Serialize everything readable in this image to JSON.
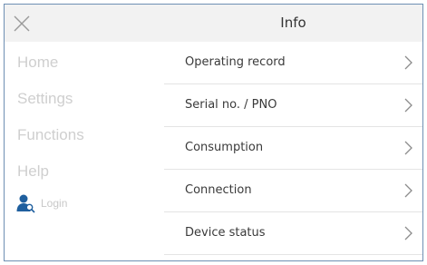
{
  "header": {
    "title": "Info",
    "close_icon": "close-icon"
  },
  "sidebar": {
    "items": [
      {
        "label": "Home"
      },
      {
        "label": "Settings"
      },
      {
        "label": "Functions"
      },
      {
        "label": "Help"
      }
    ],
    "login": {
      "label": "Login",
      "icon": "user-key-icon"
    }
  },
  "list": {
    "rows": [
      {
        "label": "Operating record"
      },
      {
        "label": "Serial no. / PNO"
      },
      {
        "label": "Consumption"
      },
      {
        "label": "Connection"
      },
      {
        "label": "Device status"
      }
    ],
    "chevron_icon": "chevron-right-icon"
  },
  "colors": {
    "header_bg": "#f2f2f2",
    "border": "#6e8fb3",
    "sidebar_text": "#cfcfcf",
    "row_text": "#3a3a3a",
    "login_icon": "#1f5f9e"
  }
}
